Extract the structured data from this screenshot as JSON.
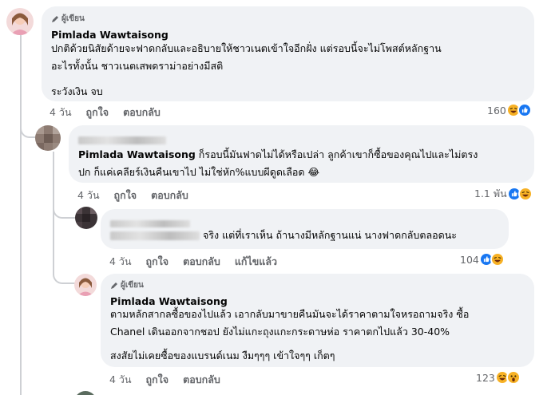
{
  "comments": [
    {
      "author_badge": "ผู้เขียน",
      "author": "Pimlada Wawtaisong",
      "lines": [
        "ปกติด้วยนิสัยด้ายจะฟาดกลับและอธิบายให้ชาวเนตเข้าใจอีกฝั่ง แต่รอบนี้จะไม่โพสต์หลักฐาน",
        "อะไรทั้งนั้น ชาวเนตเสพดราม่าอย่างมีสติ"
      ],
      "last_line": "ระวังเงิน จบ",
      "time": "4 วัน",
      "like": "ถูกใจ",
      "reply": "ตอบกลับ",
      "reaction_count": "160"
    },
    {
      "mention": "Pimlada Wawtaisong",
      "line1_rest": " ก็รอบนี้มันฟาดไม่ได้หรือเปล่า ลูกค้าเขาก็ซื้อของคุณไปและไม่ตรง",
      "line2": "ปก ก็แค่เคลียร์เงินคืนเขาไป ไม่ใช่หัก%แบบผีดูดเลือด 😂",
      "time": "4 วัน",
      "like": "ถูกใจ",
      "reply": "ตอบกลับ",
      "reaction_count": "1.1 พัน"
    },
    {
      "text_rest": " จริง แต่ที่เราเห็น ถ้านางมีหลักฐานแน่ นางฟาดกลับตลอดนะ",
      "time": "4 วัน",
      "like": "ถูกใจ",
      "reply": "ตอบกลับ",
      "edited": "แก้ไขแล้ว",
      "reaction_count": "104"
    },
    {
      "author_badge": "ผู้เขียน",
      "author": "Pimlada Wawtaisong",
      "lines": [
        "ตามหลักสากลซื้อของไปแล้ว เอากลับมาขายคืนมันจะได้ราคาตามใจหรอถามจริง ซื้อ",
        "Chanel เดินออกจากชอป ยังไม่แกะถุงแกะกระดาษห่อ ราคาตกไปแล้ว 30-40%"
      ],
      "last_line": "สงสัยไม่เคยซื้อของแบรนด์เนม งืมๆๆๆ เข้าใจๆๆ เก็ตๆ",
      "time": "4 วัน",
      "like": "ถูกใจ",
      "reply": "ตอบกลับ",
      "reaction_count": "123"
    }
  ],
  "colors": {
    "bubble": "#f0f2f5",
    "meta": "#65676b",
    "like_blue": "#1877f2",
    "haha_yellow": "#f7b125"
  }
}
